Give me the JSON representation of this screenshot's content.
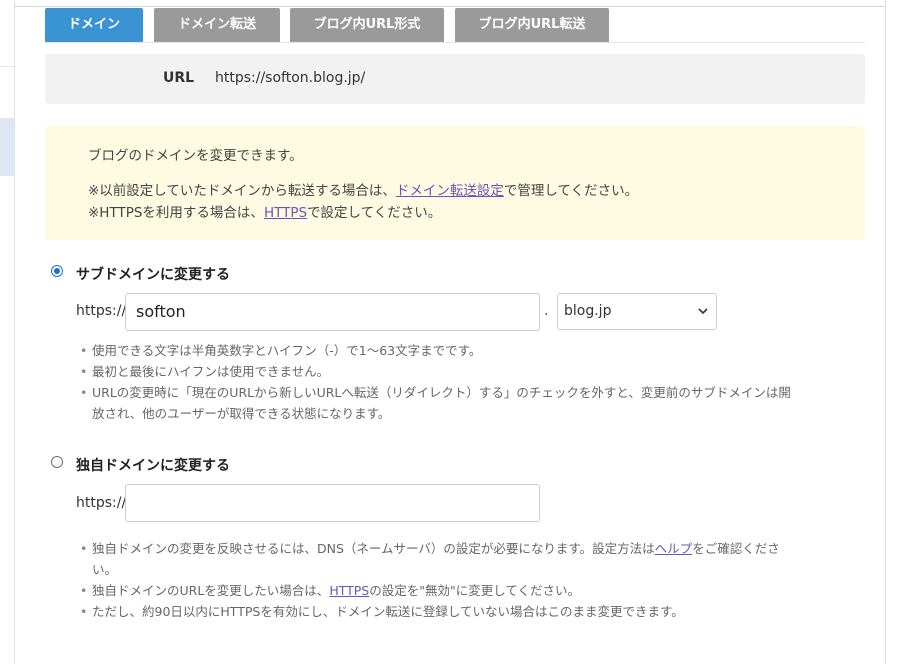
{
  "tabs": [
    {
      "label": "ドメイン",
      "active": true
    },
    {
      "label": "ドメイン転送",
      "active": false
    },
    {
      "label": "ブログ内URL形式",
      "active": false
    },
    {
      "label": "ブログ内URL転送",
      "active": false
    }
  ],
  "url_info": {
    "label": "URL",
    "value": "https://softon.blog.jp/"
  },
  "notice": {
    "line1": "ブログのドメインを変更できます。",
    "line2_pre": "※以前設定していたドメインから転送する場合は、",
    "line2_link": "ドメイン転送設定",
    "line2_post": "で管理してください。",
    "line3_pre": "※HTTPSを利用する場合は、",
    "line3_link": "HTTPS",
    "line3_post": "で設定してください。"
  },
  "subdomain": {
    "label": "サブドメインに変更する",
    "selected": true,
    "prefix": "https://",
    "value": "softon",
    "separator": ".",
    "domain_select": "blog.jp",
    "notes": [
      "使用できる文字は半角英数字とハイフン（-）で1〜63文字までです。",
      "最初と最後にハイフンは使用できません。",
      "URLの変更時に「現在のURLから新しいURLへ転送（リダイレクト）する」のチェックを外すと、変更前のサブドメインは開",
      "放され、他のユーザーが取得できる状態になります。"
    ]
  },
  "custom_domain": {
    "label": "独自ドメインに変更する",
    "selected": false,
    "prefix": "https://",
    "value": "",
    "note1_pre": "独自ドメインの変更を反映させるには、DNS（ネームサーバ）の設定が必要になります。設定方法は",
    "note1_link": "ヘルプ",
    "note1_post": "をご確認くださ",
    "note1_cont": "い。",
    "note2_pre": "独自ドメインのURLを変更したい場合は、",
    "note2_link": "HTTPS",
    "note2_post": "の設定を\"無効\"に変更してください。",
    "note3": "ただし、約90日以内にHTTPSを有効にし、ドメイン転送に登録していない場合はこのまま変更できます。"
  },
  "icons": {
    "select_arrow": "chevron-down-icon"
  },
  "colors": {
    "tab_active": "#3a93d2",
    "tab_inactive": "#9a9a9a",
    "notice_bg": "#fefbe2",
    "link": "#6a55b8"
  }
}
